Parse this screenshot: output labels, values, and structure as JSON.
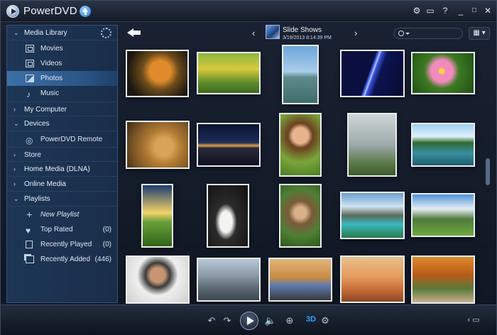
{
  "app": {
    "title": "PowerDVD"
  },
  "sidebar": {
    "media_library": "Media Library",
    "library_items": [
      "Movies",
      "Videos",
      "Photos",
      "Music"
    ],
    "my_computer": "My Computer",
    "devices": "Devices",
    "device_items": [
      "PowerDVD Remote"
    ],
    "store": "Store",
    "home_media": "Home Media (DLNA)",
    "online_media": "Online Media",
    "playlists": "Playlists",
    "playlist_items": [
      {
        "label": "New Playlist",
        "count": ""
      },
      {
        "label": "Top Rated",
        "count": "(0)"
      },
      {
        "label": "Recently Played",
        "count": "(0)"
      },
      {
        "label": "Recently Added",
        "count": "(446)"
      }
    ]
  },
  "header": {
    "album_title": "Slide Shows",
    "album_date": "3/19/2013 8:14:39 PM"
  },
  "photos": [
    "chameleon",
    "bicycle",
    "statue-of-liberty",
    "lightning",
    "pink-flower",
    "lion",
    "bridge-night",
    "woman-portrait",
    "misty-forest",
    "lake-forest",
    "sunset-field",
    "white-goose",
    "couple",
    "mountain-lake",
    "alpine-valley",
    "man-portrait",
    "city-skyline",
    "vintage-car",
    "desert-antelope",
    "autumn-cottage"
  ],
  "colors": {
    "accent": "#2fa6ff",
    "selected": "#3d70a8"
  }
}
